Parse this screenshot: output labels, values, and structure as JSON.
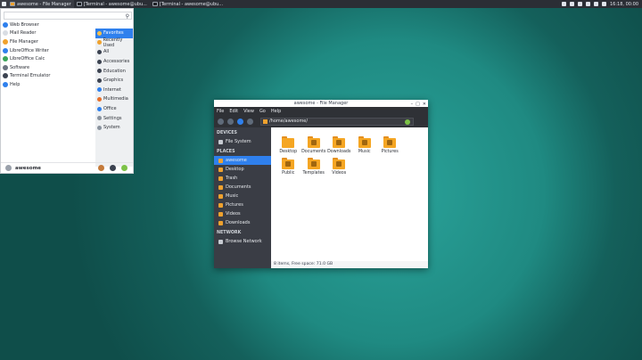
{
  "topbar": {
    "tasks": [
      {
        "label": "awesome - File Manager",
        "icon": "folder-icon",
        "active": true
      },
      {
        "label": "[Terminal - awesome@ubu...",
        "icon": "terminal-icon",
        "active": false
      },
      {
        "label": "[Terminal - awesome@ubu...",
        "icon": "terminal-icon",
        "active": false
      }
    ],
    "clock": "16:18, 00:00",
    "tray_icons": [
      "bell-icon",
      "bluetooth-icon",
      "network-icon",
      "display-icon",
      "volume-icon",
      "power-icon"
    ]
  },
  "menu": {
    "search_placeholder": "",
    "favorites": [
      {
        "label": "Web Browser",
        "icon": "web-browser-icon",
        "color": "#2f80ed"
      },
      {
        "label": "Mail Reader",
        "icon": "mail-icon",
        "color": "#d9dde3"
      },
      {
        "label": "File Manager",
        "icon": "file-manager-icon",
        "color": "#f0a22e"
      },
      {
        "label": "LibreOffice Writer",
        "icon": "writer-icon",
        "color": "#2f80ed"
      },
      {
        "label": "LibreOffice Calc",
        "icon": "calc-icon",
        "color": "#3aa55a"
      },
      {
        "label": "Software",
        "icon": "software-icon",
        "color": "#6b7480"
      },
      {
        "label": "Terminal Emulator",
        "icon": "terminal-icon",
        "color": "#3b4250"
      },
      {
        "label": "Help",
        "icon": "help-icon",
        "color": "#2f80ed"
      }
    ],
    "categories": [
      {
        "label": "Favorites",
        "icon": "star-icon",
        "color": "#ffffff",
        "selected": true
      },
      {
        "label": "Recently Used",
        "icon": "clock-icon",
        "color": "#f0a22e",
        "selected": false
      },
      {
        "label": "All",
        "icon": "grid-icon",
        "color": "#3b4250",
        "selected": false
      },
      {
        "label": "Accessories",
        "icon": "accessories-icon",
        "color": "#3b4250",
        "selected": false
      },
      {
        "label": "Education",
        "icon": "education-icon",
        "color": "#3b4250",
        "selected": false
      },
      {
        "label": "Graphics",
        "icon": "graphics-icon",
        "color": "#3b4250",
        "selected": false
      },
      {
        "label": "Internet",
        "icon": "internet-icon",
        "color": "#2f80ed",
        "selected": false
      },
      {
        "label": "Multimedia",
        "icon": "multimedia-icon",
        "color": "#e8702a",
        "selected": false
      },
      {
        "label": "Office",
        "icon": "office-icon",
        "color": "#2f80ed",
        "selected": false
      },
      {
        "label": "Settings",
        "icon": "settings-icon",
        "color": "#8a939e",
        "selected": false
      },
      {
        "label": "System",
        "icon": "system-icon",
        "color": "#8a939e",
        "selected": false
      }
    ],
    "user": {
      "name": "awesome"
    },
    "actions": [
      {
        "icon": "settings-icon",
        "color": "#c47a3a"
      },
      {
        "icon": "lock-icon",
        "color": "#3b4250"
      },
      {
        "icon": "logout-icon",
        "color": "#7cc247"
      }
    ]
  },
  "file_manager": {
    "title": "awesome - File Manager",
    "menubar": [
      "File",
      "Edit",
      "View",
      "Go",
      "Help"
    ],
    "path": "/home/awesome/",
    "sidebar": {
      "devices_heading": "DEVICES",
      "devices": [
        {
          "label": "File System",
          "icon": "drive-icon"
        }
      ],
      "places_heading": "PLACES",
      "places": [
        {
          "label": "awesome",
          "icon": "home-icon",
          "selected": true
        },
        {
          "label": "Desktop",
          "icon": "desktop-icon",
          "selected": false
        },
        {
          "label": "Trash",
          "icon": "trash-icon",
          "selected": false
        },
        {
          "label": "Documents",
          "icon": "documents-icon",
          "selected": false
        },
        {
          "label": "Music",
          "icon": "music-icon",
          "selected": false
        },
        {
          "label": "Pictures",
          "icon": "pictures-icon",
          "selected": false
        },
        {
          "label": "Videos",
          "icon": "videos-icon",
          "selected": false
        },
        {
          "label": "Downloads",
          "icon": "downloads-icon",
          "selected": false
        }
      ],
      "network_heading": "NETWORK",
      "network": [
        {
          "label": "Browse Network",
          "icon": "network-icon"
        }
      ]
    },
    "items": [
      {
        "label": "Desktop",
        "icon": "folder-icon"
      },
      {
        "label": "Documents",
        "icon": "folder-documents-icon"
      },
      {
        "label": "Downloads",
        "icon": "folder-downloads-icon"
      },
      {
        "label": "Music",
        "icon": "folder-music-icon"
      },
      {
        "label": "Pictures",
        "icon": "folder-pictures-icon"
      },
      {
        "label": "Public",
        "icon": "folder-public-icon"
      },
      {
        "label": "Templates",
        "icon": "folder-templates-icon"
      },
      {
        "label": "Videos",
        "icon": "folder-videos-icon"
      }
    ],
    "status": "8 items, Free space: 71.0 GB"
  }
}
